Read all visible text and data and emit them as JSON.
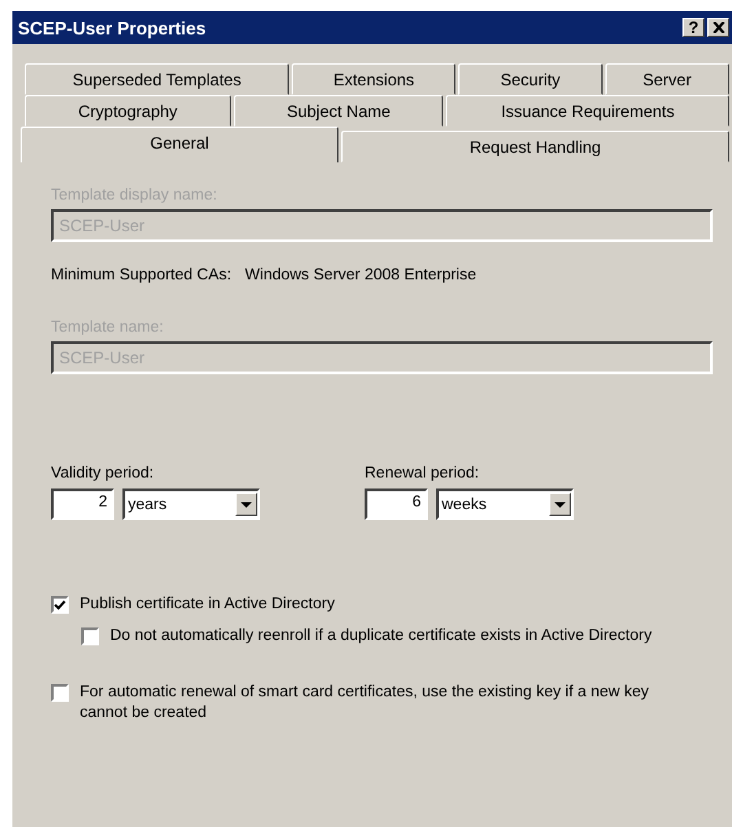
{
  "window": {
    "title": "SCEP-User Properties",
    "help_button": "?"
  },
  "tab_rows": [
    [
      {
        "label": "Superseded Templates",
        "selected": false
      },
      {
        "label": "Extensions",
        "selected": false
      },
      {
        "label": "Security",
        "selected": false
      },
      {
        "label": "Server",
        "selected": false
      }
    ],
    [
      {
        "label": "Cryptography",
        "selected": false
      },
      {
        "label": "Subject Name",
        "selected": false
      },
      {
        "label": "Issuance Requirements",
        "selected": false
      }
    ],
    [
      {
        "label": "General",
        "selected": true
      },
      {
        "label": "Request Handling",
        "selected": false
      }
    ]
  ],
  "template_display_name": {
    "label": "Template display name:",
    "value": "SCEP-User",
    "disabled": true
  },
  "minimum_supported_cas": {
    "label": "Minimum Supported CAs:",
    "value": "Windows Server 2008 Enterprise"
  },
  "template_name": {
    "label": "Template name:",
    "value": "SCEP-User",
    "disabled": true
  },
  "periods": [
    {
      "label": "Validity period:",
      "number": "2",
      "unit": "years"
    },
    {
      "label": "Renewal period:",
      "number": "6",
      "unit": "weeks"
    }
  ],
  "options": [
    {
      "label": "Publish certificate in Active Directory",
      "checked": true,
      "children": [
        {
          "label": "Do not automatically reenroll if a duplicate certificate exists in Active Directory",
          "checked": false
        }
      ]
    },
    {
      "label": "For automatic renewal of smart card certificates, use the existing key if a new key cannot be created",
      "checked": false
    }
  ]
}
